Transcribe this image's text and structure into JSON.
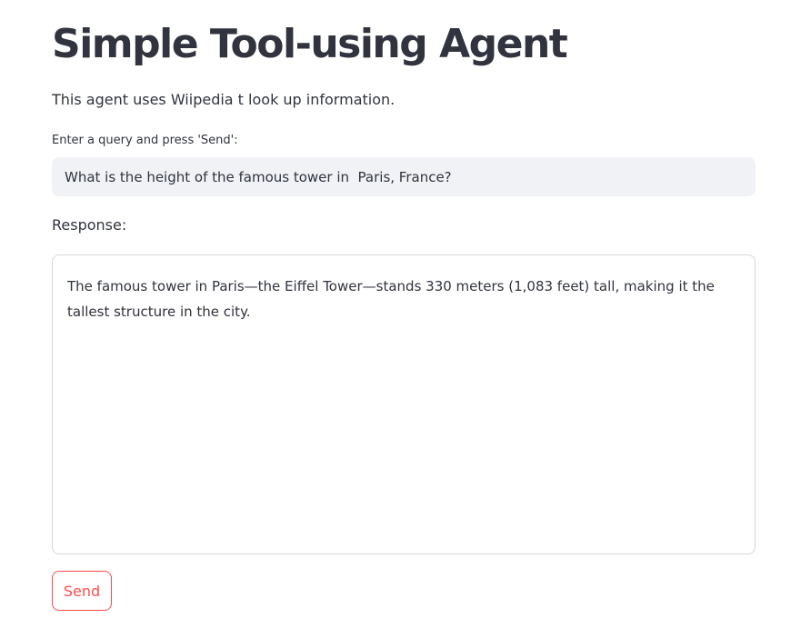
{
  "page": {
    "title": "Simple Tool-using Agent",
    "intro": "This agent uses Wiipedia t look up information."
  },
  "query": {
    "label": "Enter a query and press 'Send':",
    "value": "What is the height of the famous tower in  Paris, France?"
  },
  "response": {
    "label": "Response:",
    "value": "The famous tower in Paris—the Eiffel Tower—stands 330 meters (1,083 feet) tall, making it the tallest structure in the city."
  },
  "actions": {
    "send_label": "Send"
  },
  "colors": {
    "text": "#31333f",
    "accent": "#ff4b4b",
    "input_background": "#f0f2f6",
    "border": "#d6d6d9"
  }
}
